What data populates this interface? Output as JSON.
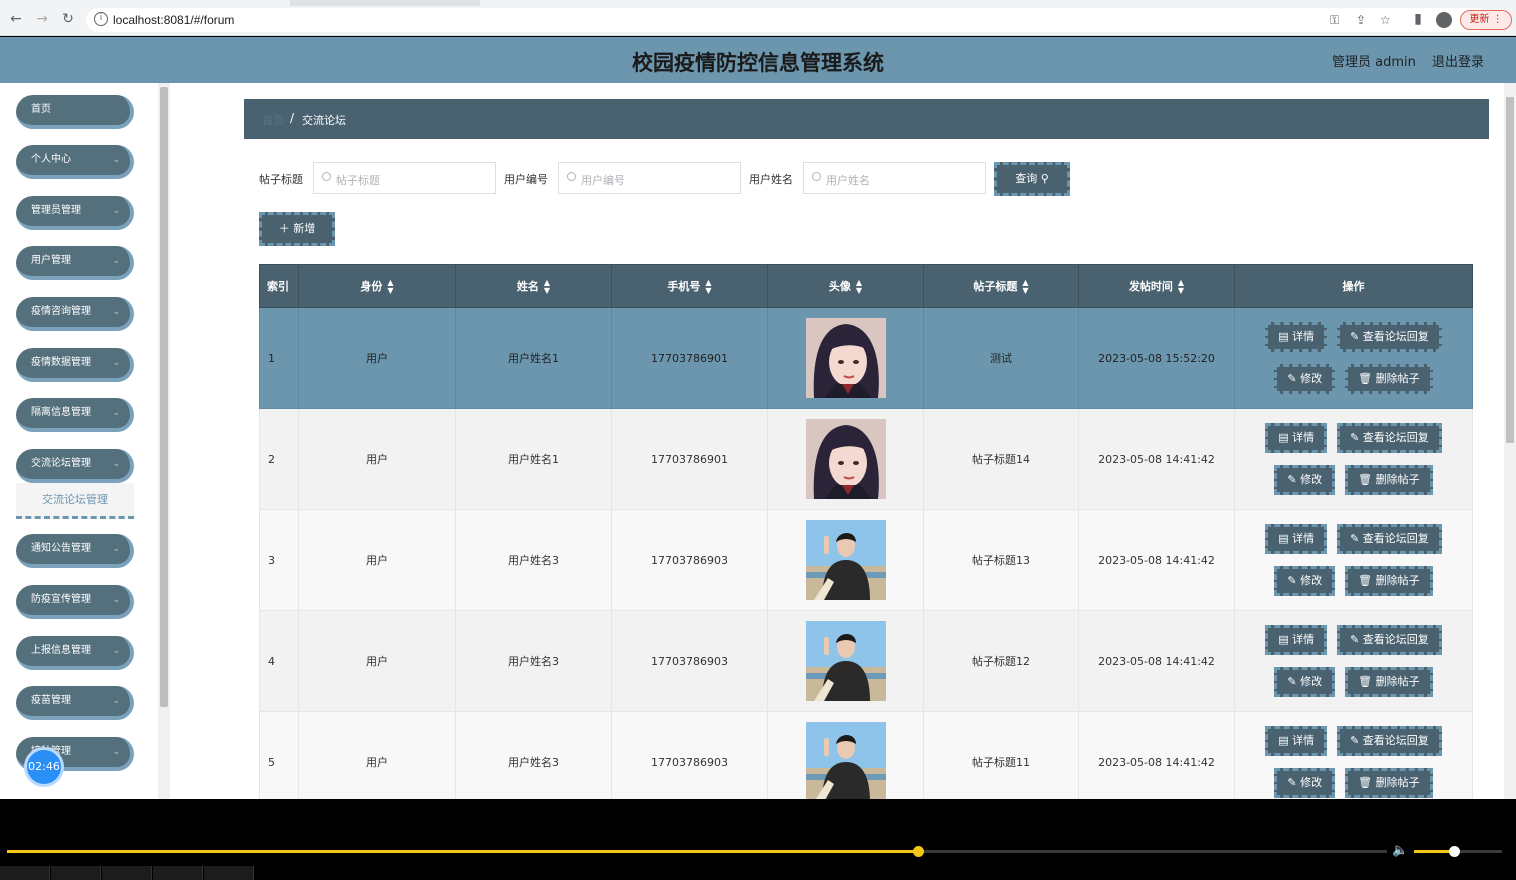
{
  "browser": {
    "url": "localhost:8081/#/forum",
    "update_label": "更新"
  },
  "header": {
    "title": "校园疫情防控信息管理系统",
    "user": "管理员 admin",
    "logout": "退出登录"
  },
  "sidebar": {
    "items": [
      {
        "label": "首页"
      },
      {
        "label": "个人中心"
      },
      {
        "label": "管理员管理"
      },
      {
        "label": "用户管理"
      },
      {
        "label": "疫情咨询管理"
      },
      {
        "label": "疫情数据管理"
      },
      {
        "label": "隔离信息管理"
      },
      {
        "label": "交流论坛管理"
      },
      {
        "label": "通知公告管理"
      },
      {
        "label": "防疫宣传管理"
      },
      {
        "label": "上报信息管理"
      },
      {
        "label": "疫苗管理"
      },
      {
        "label": "接种管理"
      }
    ],
    "active_sub": "交流论坛管理",
    "timer": "02:46"
  },
  "breadcrumb": {
    "home": "首页",
    "current": "交流论坛"
  },
  "filters": {
    "title_label": "帖子标题",
    "title_placeholder": "帖子标题",
    "userno_label": "用户编号",
    "userno_placeholder": "用户编号",
    "username_label": "用户姓名",
    "username_placeholder": "用户姓名",
    "search_label": "查询"
  },
  "add_label": "新增",
  "table": {
    "headers": [
      "索引",
      "身份",
      "姓名",
      "手机号",
      "头像",
      "帖子标题",
      "发帖时间",
      "操作"
    ],
    "rows": [
      {
        "index": "1",
        "identity": "用户",
        "name": "用户姓名1",
        "phone": "17703786901",
        "avatar": "girl",
        "title": "测试",
        "time": "2023-05-08 15:52:20"
      },
      {
        "index": "2",
        "identity": "用户",
        "name": "用户姓名1",
        "phone": "17703786901",
        "avatar": "girl",
        "title": "帖子标题14",
        "time": "2023-05-08 14:41:42"
      },
      {
        "index": "3",
        "identity": "用户",
        "name": "用户姓名3",
        "phone": "17703786903",
        "avatar": "boy",
        "title": "帖子标题13",
        "time": "2023-05-08 14:41:42"
      },
      {
        "index": "4",
        "identity": "用户",
        "name": "用户姓名3",
        "phone": "17703786903",
        "avatar": "boy",
        "title": "帖子标题12",
        "time": "2023-05-08 14:41:42"
      },
      {
        "index": "5",
        "identity": "用户",
        "name": "用户姓名3",
        "phone": "17703786903",
        "avatar": "boy",
        "title": "帖子标题11",
        "time": "2023-05-08 14:41:42"
      }
    ],
    "ops": {
      "detail": "详情",
      "replies": "查看论坛回复",
      "edit": "修改",
      "delete": "删除帖子"
    }
  },
  "player": {
    "progress": 0.66,
    "volume": 0.45
  },
  "colors": {
    "header": "#6b96ae",
    "dark": "#4a6270",
    "accent": "#6b96ae"
  }
}
